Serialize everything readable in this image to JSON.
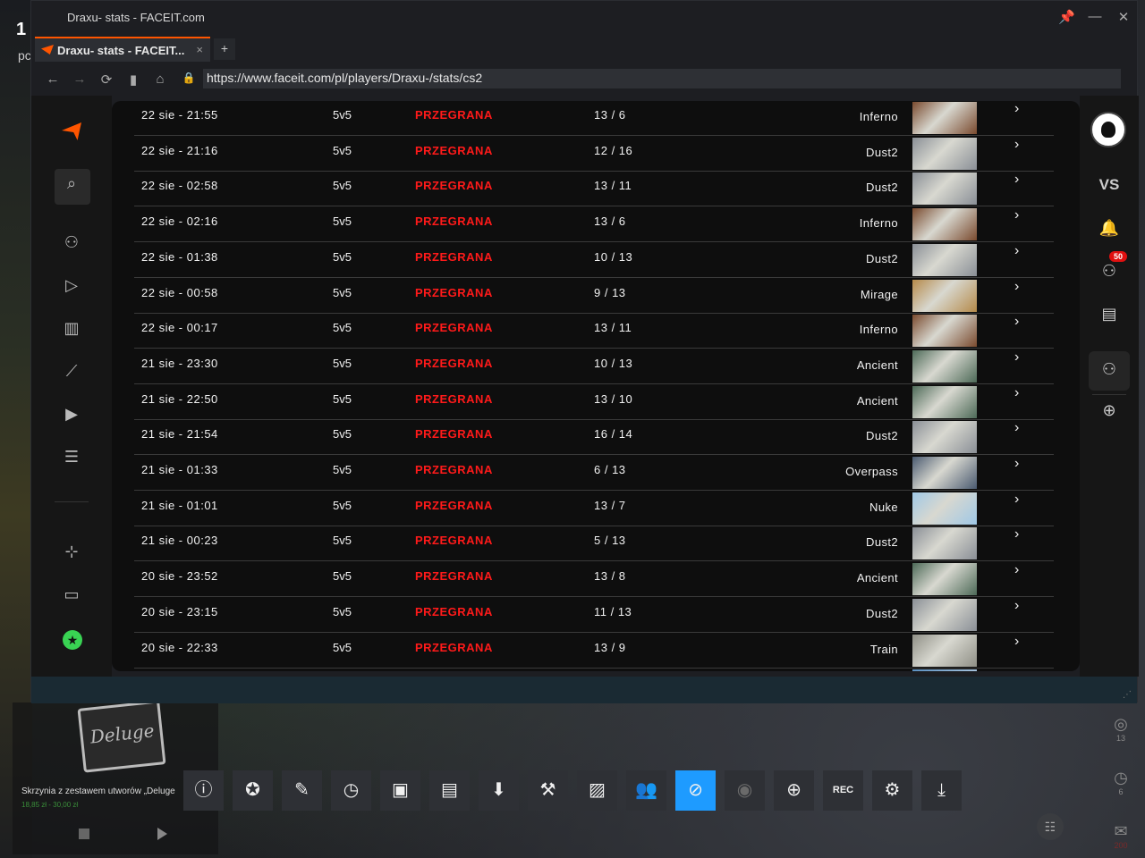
{
  "window": {
    "title": "Draxu- stats - FACEIT.com",
    "tab_label": "Draxu- stats - FACEIT...",
    "new_tab_label": "+",
    "url": "https://www.faceit.com/pl/players/Draxu-/stats/cs2"
  },
  "matches": [
    {
      "date": "22 sie - 21:55",
      "mode": "5v5",
      "result": "PRZEGRANA",
      "score": "13 / 6",
      "map": "Inferno"
    },
    {
      "date": "22 sie - 21:16",
      "mode": "5v5",
      "result": "PRZEGRANA",
      "score": "12 / 16",
      "map": "Dust2"
    },
    {
      "date": "22 sie - 02:58",
      "mode": "5v5",
      "result": "PRZEGRANA",
      "score": "13 / 11",
      "map": "Dust2"
    },
    {
      "date": "22 sie - 02:16",
      "mode": "5v5",
      "result": "PRZEGRANA",
      "score": "13 / 6",
      "map": "Inferno"
    },
    {
      "date": "22 sie - 01:38",
      "mode": "5v5",
      "result": "PRZEGRANA",
      "score": "10 / 13",
      "map": "Dust2"
    },
    {
      "date": "22 sie - 00:58",
      "mode": "5v5",
      "result": "PRZEGRANA",
      "score": "9 / 13",
      "map": "Mirage"
    },
    {
      "date": "22 sie - 00:17",
      "mode": "5v5",
      "result": "PRZEGRANA",
      "score": "13 / 11",
      "map": "Inferno"
    },
    {
      "date": "21 sie - 23:30",
      "mode": "5v5",
      "result": "PRZEGRANA",
      "score": "10 / 13",
      "map": "Ancient"
    },
    {
      "date": "21 sie - 22:50",
      "mode": "5v5",
      "result": "PRZEGRANA",
      "score": "13 / 10",
      "map": "Ancient"
    },
    {
      "date": "21 sie - 21:54",
      "mode": "5v5",
      "result": "PRZEGRANA",
      "score": "16 / 14",
      "map": "Dust2"
    },
    {
      "date": "21 sie - 01:33",
      "mode": "5v5",
      "result": "PRZEGRANA",
      "score": "6 / 13",
      "map": "Overpass"
    },
    {
      "date": "21 sie - 01:01",
      "mode": "5v5",
      "result": "PRZEGRANA",
      "score": "13 / 7",
      "map": "Nuke"
    },
    {
      "date": "21 sie - 00:23",
      "mode": "5v5",
      "result": "PRZEGRANA",
      "score": "5 / 13",
      "map": "Dust2"
    },
    {
      "date": "20 sie - 23:52",
      "mode": "5v5",
      "result": "PRZEGRANA",
      "score": "13 / 8",
      "map": "Ancient"
    },
    {
      "date": "20 sie - 23:15",
      "mode": "5v5",
      "result": "PRZEGRANA",
      "score": "11 / 13",
      "map": "Dust2"
    },
    {
      "date": "20 sie - 22:33",
      "mode": "5v5",
      "result": "PRZEGRANA",
      "score": "13 / 9",
      "map": "Train"
    }
  ],
  "map_colors": {
    "Inferno": "#7a4a2e",
    "Dust2": "#8a8f96",
    "Mirage": "#b58a4a",
    "Ancient": "#4d6a58",
    "Overpass": "#4a5a70",
    "Nuke": "#9fc8e6",
    "Train": "#8f8f86"
  },
  "right_sidebar": {
    "vs_label": "VS",
    "friends_badge": "50"
  },
  "background": {
    "store_item_title": "Skrzynia z zestawem utworów „Deluge",
    "store_item_price": "18,85 zł - 30,00 zł",
    "crate_label": "Deluge",
    "widget_counts": [
      "13",
      "6",
      "200"
    ],
    "frag_big": "1",
    "frag_small": "pc"
  },
  "toolbar_items": [
    {
      "name": "info",
      "glyph": "ⓘ"
    },
    {
      "name": "achievements",
      "glyph": "✪"
    },
    {
      "name": "edit",
      "glyph": "✎"
    },
    {
      "name": "history",
      "glyph": "◷"
    },
    {
      "name": "guide",
      "glyph": "▣"
    },
    {
      "name": "chat",
      "glyph": "▤"
    },
    {
      "name": "download",
      "glyph": "⬇"
    },
    {
      "name": "settings-tools",
      "glyph": "⚒"
    },
    {
      "name": "screenshots",
      "glyph": "▨"
    },
    {
      "name": "friends",
      "glyph": "👥"
    },
    {
      "name": "browser",
      "glyph": "⊘"
    },
    {
      "name": "controller",
      "glyph": "◉"
    },
    {
      "name": "web",
      "glyph": "⊕"
    },
    {
      "name": "record",
      "glyph": "REC"
    },
    {
      "name": "settings",
      "glyph": "⚙"
    },
    {
      "name": "minimize",
      "glyph": "⤓"
    }
  ]
}
